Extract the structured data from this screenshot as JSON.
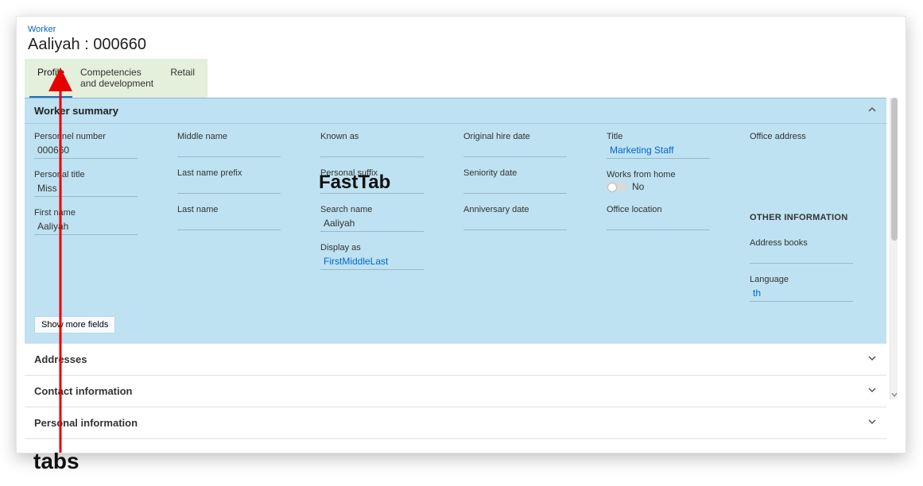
{
  "breadcrumb": "Worker",
  "page_title": "Aaliyah : 000660",
  "tabs": [
    {
      "label": "Profile",
      "active": true
    },
    {
      "label": "Competencies and development",
      "active": false
    },
    {
      "label": "Retail",
      "active": false
    }
  ],
  "annotations": {
    "fasttab_label": "FastTab",
    "tabs_label": "tabs"
  },
  "worker_summary": {
    "title": "Worker summary",
    "show_more": "Show more fields",
    "fields": {
      "personnel_number": {
        "label": "Personnel number",
        "value": "000660"
      },
      "personal_title": {
        "label": "Personal title",
        "value": "Miss"
      },
      "first_name": {
        "label": "First name",
        "value": "Aaliyah"
      },
      "middle_name": {
        "label": "Middle name",
        "value": ""
      },
      "last_name_prefix": {
        "label": "Last name prefix",
        "value": ""
      },
      "last_name": {
        "label": "Last name",
        "value": ""
      },
      "known_as": {
        "label": "Known as",
        "value": ""
      },
      "personal_suffix": {
        "label": "Personal suffix",
        "value": ""
      },
      "search_name": {
        "label": "Search name",
        "value": "Aaliyah"
      },
      "display_as": {
        "label": "Display as",
        "value": "FirstMiddleLast"
      },
      "original_hire": {
        "label": "Original hire date",
        "value": ""
      },
      "seniority": {
        "label": "Seniority date",
        "value": ""
      },
      "anniversary": {
        "label": "Anniversary date",
        "value": ""
      },
      "title": {
        "label": "Title",
        "value": "Marketing Staff"
      },
      "works_from_home": {
        "label": "Works from home",
        "value": "No"
      },
      "office_location": {
        "label": "Office location",
        "value": ""
      },
      "office_address": {
        "label": "Office address",
        "value": ""
      },
      "other_info_heading": "OTHER INFORMATION",
      "address_books": {
        "label": "Address books",
        "value": ""
      },
      "language": {
        "label": "Language",
        "value": "th"
      }
    }
  },
  "closed_fasttabs": [
    {
      "title": "Addresses"
    },
    {
      "title": "Contact information"
    },
    {
      "title": "Personal information"
    }
  ]
}
